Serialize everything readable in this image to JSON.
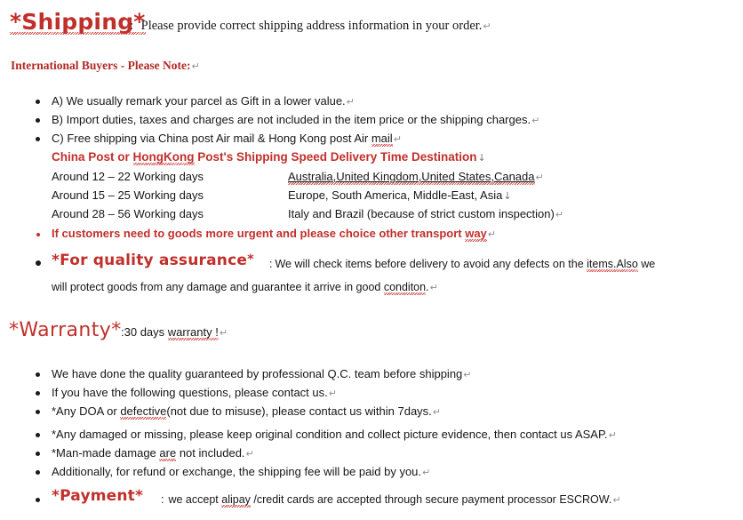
{
  "document": {
    "title": "Shipping / Warranty / Payment Policy",
    "accent_color": "#c0302b",
    "text_color": "#161616",
    "background_color": "#ffffff",
    "return_mark": "↵",
    "down_mark": "↓"
  },
  "shipping": {
    "heading": "*Shipping*",
    "separator": ":",
    "intro": "Please provide correct shipping address information in your order.",
    "international_note": "International Buyers - Please Note:",
    "bullets": [
      "A) We usually remark your parcel as Gift in a lower value.",
      "B) Import duties, taxes and charges are not included in the item price or the shipping charges.",
      "C) Free shipping via China post Air mail & Hong Kong post Air mail."
    ],
    "bullet_c_prefix": "C) Free shipping via China post Air mail & Hong Kong post Air ",
    "bullet_c_misspelled": "mail",
    "table_heading_part1": "China Post or ",
    "table_heading_misspelled": "HongKong",
    "table_heading_part2": " Post's Shipping Speed Delivery Time Destination",
    "delivery_table": {
      "columns": [
        "Shipping Speed",
        "Destination"
      ],
      "rows": [
        {
          "speed": "Around 12 – 22 Working days",
          "destination": "Australia,United Kingdom,United States,Canada",
          "destination_underlined": true
        },
        {
          "speed": "Around 15 – 25 Working days",
          "destination": "Europe, South America, Middle-East, Asia",
          "destination_underlined": false
        },
        {
          "speed": "Around 28 – 56 Working days",
          "destination": "Italy and Brazil (because of strict custom inspection)",
          "destination_underlined": false
        }
      ]
    },
    "urgent_note_prefix": "If customers need to goods more urgent and please choice other transport ",
    "urgent_note_misspelled": "way"
  },
  "quality_assurance": {
    "heading": "*For quality assurance",
    "heading_star": "*",
    "separator": ":",
    "line1_part1": "We will check items before delivery to avoid any defects on the ",
    "line1_misspelled": "items.Also",
    "line1_part2": " we",
    "line2_part1": "will protect goods from any damage and guarantee it arrive in good ",
    "line2_misspelled": "conditon",
    "line2_part2": "."
  },
  "warranty": {
    "heading": "*Warranty*",
    "separator": ":",
    "value_prefix": "30 days ",
    "value_misspelled": "warranty !",
    "bullets": [
      "We have done the quality guaranteed by professional Q.C. team before shipping",
      "If you have the following questions, please contact us.",
      "*Any DOA or defective(not due to misuse), please contact us within 7days.",
      "*Any damaged or missing, please keep original condition and collect picture evidence, then contact us ASAP.",
      "*Man-made damage are not included.",
      "Additionally, for refund or exchange, the shipping fee will be paid by you."
    ],
    "bullet3_prefix": "*Any DOA or ",
    "bullet3_misspelled": "defective",
    "bullet3_suffix": "(not due to misuse), please contact us within 7days.",
    "bullet5_prefix": "*Man-made damage ",
    "bullet5_misspelled": "are",
    "bullet5_suffix": " not included."
  },
  "payment": {
    "heading": "*Payment*",
    "separator": ":",
    "text_prefix": "we accept ",
    "text_misspelled": "alipay",
    "text_suffix": " /credit cards are accepted through secure payment processor ESCROW."
  }
}
